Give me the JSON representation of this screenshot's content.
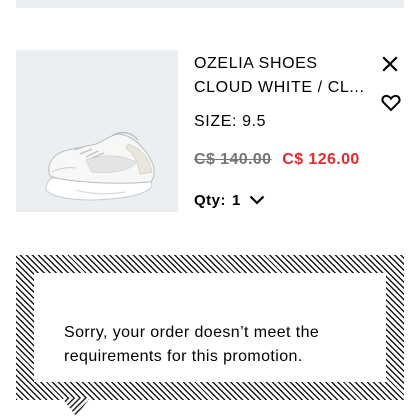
{
  "cart_item": {
    "name_line1": "OZELIA SHOES",
    "name_line2": "CLOUD WHITE / CL...",
    "size_label": "SIZE:",
    "size_value": "9.5",
    "original_price": "C$ 140.00",
    "sale_price": "C$ 126.00",
    "qty_label": "Qty:",
    "qty_value": "1",
    "image_icon": "sneaker-image",
    "remove_icon": "close-icon",
    "wishlist_icon": "heart-icon",
    "qty_icon": "chevron-down-icon"
  },
  "promo_message": {
    "line1": "Sorry, your order doesn’t meet the",
    "line2": "requirements for this promotion."
  },
  "colors": {
    "sale_price": "#e32b2b",
    "original_price": "#767677",
    "image_background": "#eceff1",
    "text": "#000000"
  }
}
